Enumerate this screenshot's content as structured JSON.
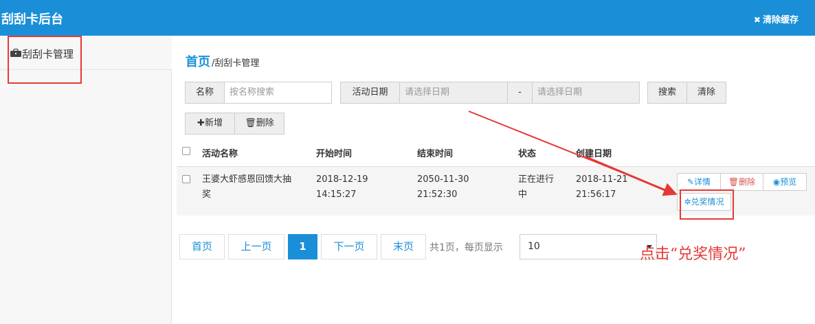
{
  "header": {
    "title": "刮刮卡后台",
    "clear_cache": "清除缓存"
  },
  "sidebar": {
    "items": [
      {
        "label": "刮刮卡管理"
      }
    ]
  },
  "breadcrumb": {
    "home": "首页",
    "current": "/刮刮卡管理"
  },
  "filters": {
    "name_label": "名称",
    "name_placeholder": "按名称搜索",
    "date_label": "活动日期",
    "date_start_placeholder": "请选择日期",
    "date_sep": "-",
    "date_end_placeholder": "请选择日期",
    "search_button": "搜索",
    "clear_button": "清除"
  },
  "toolbar": {
    "add_label": "新增",
    "delete_label": "删除"
  },
  "table": {
    "columns": [
      "活动名称",
      "开始时间",
      "结束时间",
      "状态",
      "创建日期"
    ],
    "rows": [
      {
        "name_line1": "王婆大虾感恩回馈大抽",
        "name_line2": "奖",
        "start_date": "2018-12-19",
        "start_time": "14:15:27",
        "end_date": "2050-11-30",
        "end_time": "21:52:30",
        "status_line1": "正在进行",
        "status_line2": "中",
        "created_date": "2018-11-21",
        "created_time": "21:56:17",
        "actions": {
          "detail": "详情",
          "delete": "删除",
          "preview": "预览",
          "prize": "兑奖情况"
        }
      }
    ]
  },
  "pagination": {
    "first": "首页",
    "prev": "上一页",
    "current": "1",
    "next": "下一页",
    "last": "末页",
    "info": "共1页，每页显示",
    "page_size": "10"
  },
  "annotation": {
    "text": "点击“兑奖情况”"
  },
  "colors": {
    "primary": "#1a8fd8",
    "annotation": "#e53935"
  }
}
